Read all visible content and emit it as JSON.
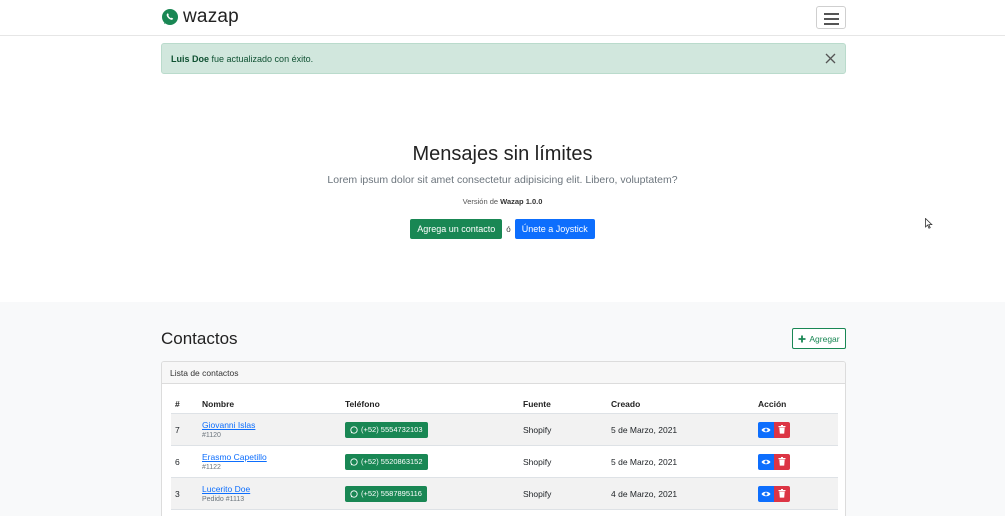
{
  "brand": {
    "name": "wazap"
  },
  "alert": {
    "name": "Luis Doe",
    "message": " fue actualizado con éxito."
  },
  "hero": {
    "title": "Mensajes sin límites",
    "lead": "Lorem ipsum dolor sit amet consectetur adipisicing elit. Libero, voluptatem?",
    "version_label": "Versión de ",
    "version_value": "Wazap 1.0.0",
    "add_contact_label": "Agrega un contacto",
    "or_label": "ó",
    "joystick_label": "Únete a Joystick"
  },
  "contacts": {
    "title": "Contactos",
    "add_label": "Agregar",
    "card_header": "Lista de contactos",
    "columns": {
      "id": "#",
      "name": "Nombre",
      "phone": "Teléfono",
      "source": "Fuente",
      "created": "Creado",
      "action": "Acción"
    },
    "rows": [
      {
        "id": "7",
        "name": "Giovanni Islas",
        "sub": "#1120",
        "phone": "(+52) 5554732103",
        "source": "Shopify",
        "created": "5 de Marzo, 2021"
      },
      {
        "id": "6",
        "name": "Erasmo Capetillo",
        "sub": "#1122",
        "phone": "(+52) 5520863152",
        "source": "Shopify",
        "created": "5 de Marzo, 2021"
      },
      {
        "id": "3",
        "name": "Lucerito Doe",
        "sub": "Pedido #1113",
        "phone": "(+52) 5587895116",
        "source": "Shopify",
        "created": "4 de Marzo, 2021"
      }
    ]
  },
  "icons": {
    "logo": "whatsapp-icon",
    "menu": "hamburger-icon",
    "close": "close-icon",
    "add": "plus-icon",
    "phone": "whatsapp-icon",
    "view": "eye-icon",
    "delete": "trash-icon"
  },
  "colors": {
    "success": "#198754",
    "primary": "#0d6efd",
    "danger": "#dc3545",
    "alert_bg": "#d1e7dd"
  }
}
